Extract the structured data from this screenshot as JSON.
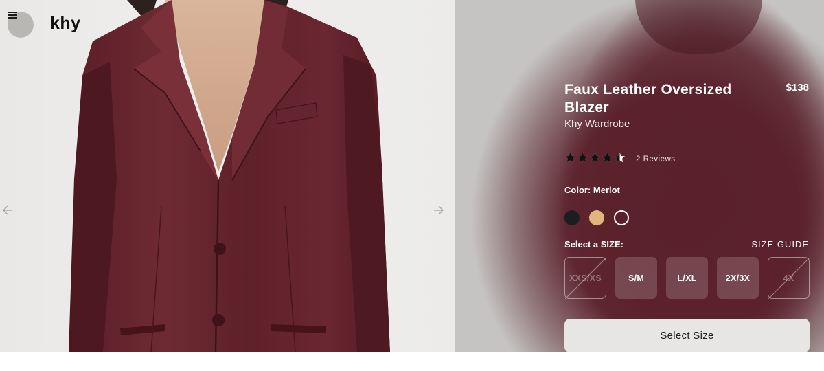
{
  "header": {
    "brand_logo": "khy",
    "menu_icon": "hamburger-menu-icon"
  },
  "gallery": {
    "prev_icon": "arrow-left-icon",
    "next_icon": "arrow-right-icon"
  },
  "product": {
    "title": "Faux Leather Oversized Blazer",
    "brand": "Khy Wardrobe",
    "price": "$138",
    "rating": 4.5,
    "rating_max": 5,
    "reviews_label": "2 Reviews",
    "color_label": "Color: Merlot",
    "swatches": [
      {
        "name": "black",
        "color": "#1c1d20",
        "selected": false
      },
      {
        "name": "tan",
        "color": "#e2b57c",
        "selected": false
      },
      {
        "name": "merlot",
        "color": "#5b1f2c",
        "selected": true
      }
    ],
    "size_label": "Select a SIZE:",
    "size_guide_label": "SIZE GUIDE",
    "sizes": [
      {
        "label": "XXS/XS",
        "available": false
      },
      {
        "label": "S/M",
        "available": true
      },
      {
        "label": "L/XL",
        "available": true
      },
      {
        "label": "2X/3X",
        "available": true
      },
      {
        "label": "4X",
        "available": false
      }
    ],
    "cta_label": "Select Size"
  },
  "colors": {
    "panel_merlot": "#5c222c",
    "button_bg": "#e8e6e4"
  }
}
